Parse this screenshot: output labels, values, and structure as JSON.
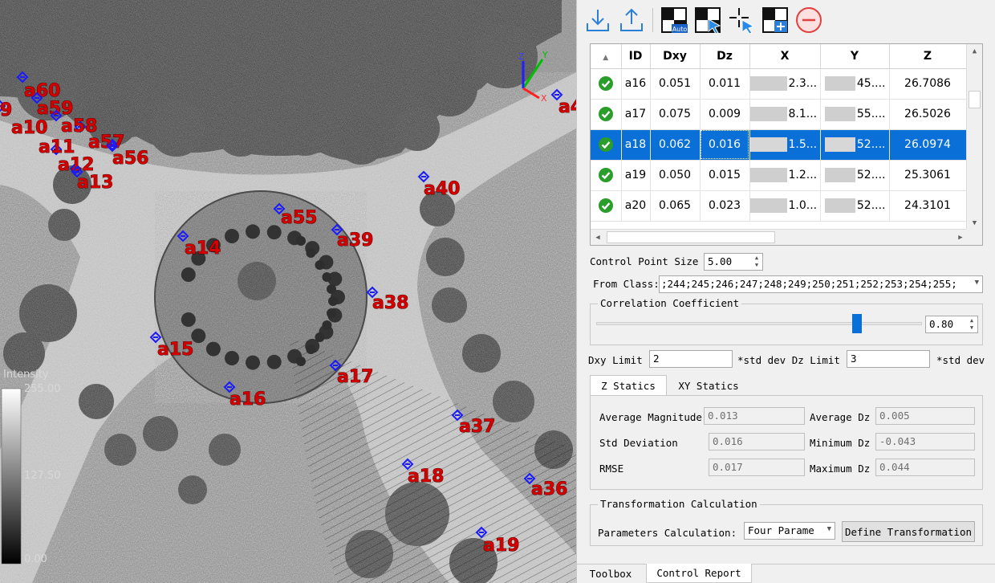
{
  "viewport": {
    "legend_title": "Intensity",
    "legend_max": "255.00",
    "legend_mid": "127.50",
    "legend_min": "0.00",
    "axis_x": "X",
    "axis_y": "Y",
    "axis_z": "Z",
    "control_points": [
      {
        "label": "a60"
      },
      {
        "label": "a59"
      },
      {
        "label": "a10"
      },
      {
        "label": "a58"
      },
      {
        "label": "a57"
      },
      {
        "label": "a11"
      },
      {
        "label": "a12"
      },
      {
        "label": "a56"
      },
      {
        "label": "a13"
      },
      {
        "label": "a40"
      },
      {
        "label": "a55"
      },
      {
        "label": "a39"
      },
      {
        "label": "a14"
      },
      {
        "label": "a38"
      },
      {
        "label": "a15"
      },
      {
        "label": "a17"
      },
      {
        "label": "a16"
      },
      {
        "label": "a37"
      },
      {
        "label": "a18"
      },
      {
        "label": "a36"
      },
      {
        "label": "a19"
      },
      {
        "label": "a4"
      },
      {
        "label": "9"
      }
    ]
  },
  "toolbar": {
    "items": [
      "import-icon",
      "export-icon",
      "auto-icon",
      "select-icon",
      "pick-point-icon",
      "add-point-icon",
      "delete-icon"
    ],
    "auto_text": "Auto"
  },
  "table": {
    "headers": [
      "",
      "ID",
      "Dxy",
      "Dz",
      "X",
      "Y",
      "Z"
    ],
    "rows": [
      {
        "id": "a16",
        "dxy": "0.051",
        "dz": "0.011",
        "x": "2.3...",
        "y": "45....",
        "z": "26.7086",
        "selected": false
      },
      {
        "id": "a17",
        "dxy": "0.075",
        "dz": "0.009",
        "x": "8.1...",
        "y": "55....",
        "z": "26.5026",
        "selected": false
      },
      {
        "id": "a18",
        "dxy": "0.062",
        "dz": "0.016",
        "x": "1.5...",
        "y": "52....",
        "z": "26.0974",
        "selected": true
      },
      {
        "id": "a19",
        "dxy": "0.050",
        "dz": "0.015",
        "x": "1.2...",
        "y": "52....",
        "z": "25.3061",
        "selected": false
      },
      {
        "id": "a20",
        "dxy": "0.065",
        "dz": "0.023",
        "x": "1.0...",
        "y": "52....",
        "z": "24.3101",
        "selected": false
      }
    ],
    "status_color": "#2a9d2a",
    "selection_color": "#0a70d8"
  },
  "form": {
    "control_point_size_label": "Control Point Size",
    "control_point_size_value": "5.00",
    "from_class_label": "From Class:",
    "from_class_value": ";244;245;246;247;248;249;250;251;252;253;254;255;",
    "correlation_title": "Correlation Coefficient",
    "correlation_value": "0.80",
    "correlation_level": 0.8,
    "dxy_limit_label": "Dxy Limit",
    "dxy_limit_value": "2",
    "dz_limit_label": "*std dev Dz Limit",
    "dz_limit_value": "3",
    "std_dev_suffix": "*std dev"
  },
  "stats_tabs": [
    {
      "label": "Z Statics",
      "active": true
    },
    {
      "label": "XY Statics",
      "active": false
    }
  ],
  "stats": {
    "average_magnitude_label": "Average Magnitude",
    "average_magnitude": "0.013",
    "average_dz_label": "Average Dz",
    "average_dz": "0.005",
    "std_deviation_label": "Std Deviation",
    "std_deviation": "0.016",
    "minimum_dz_label": "Minimum Dz",
    "minimum_dz": "-0.043",
    "rmse_label": "RMSE",
    "rmse": "0.017",
    "maximum_dz_label": "Maximum Dz",
    "maximum_dz": "0.044"
  },
  "transformation": {
    "title": "Transformation Calculation",
    "parameters_label": "Parameters Calculation:",
    "parameters_value": "Four Parame",
    "define_button": "Define Transformation"
  },
  "bottom_tabs": [
    {
      "label": "Toolbox",
      "active": false
    },
    {
      "label": "Control Report",
      "active": true
    }
  ]
}
